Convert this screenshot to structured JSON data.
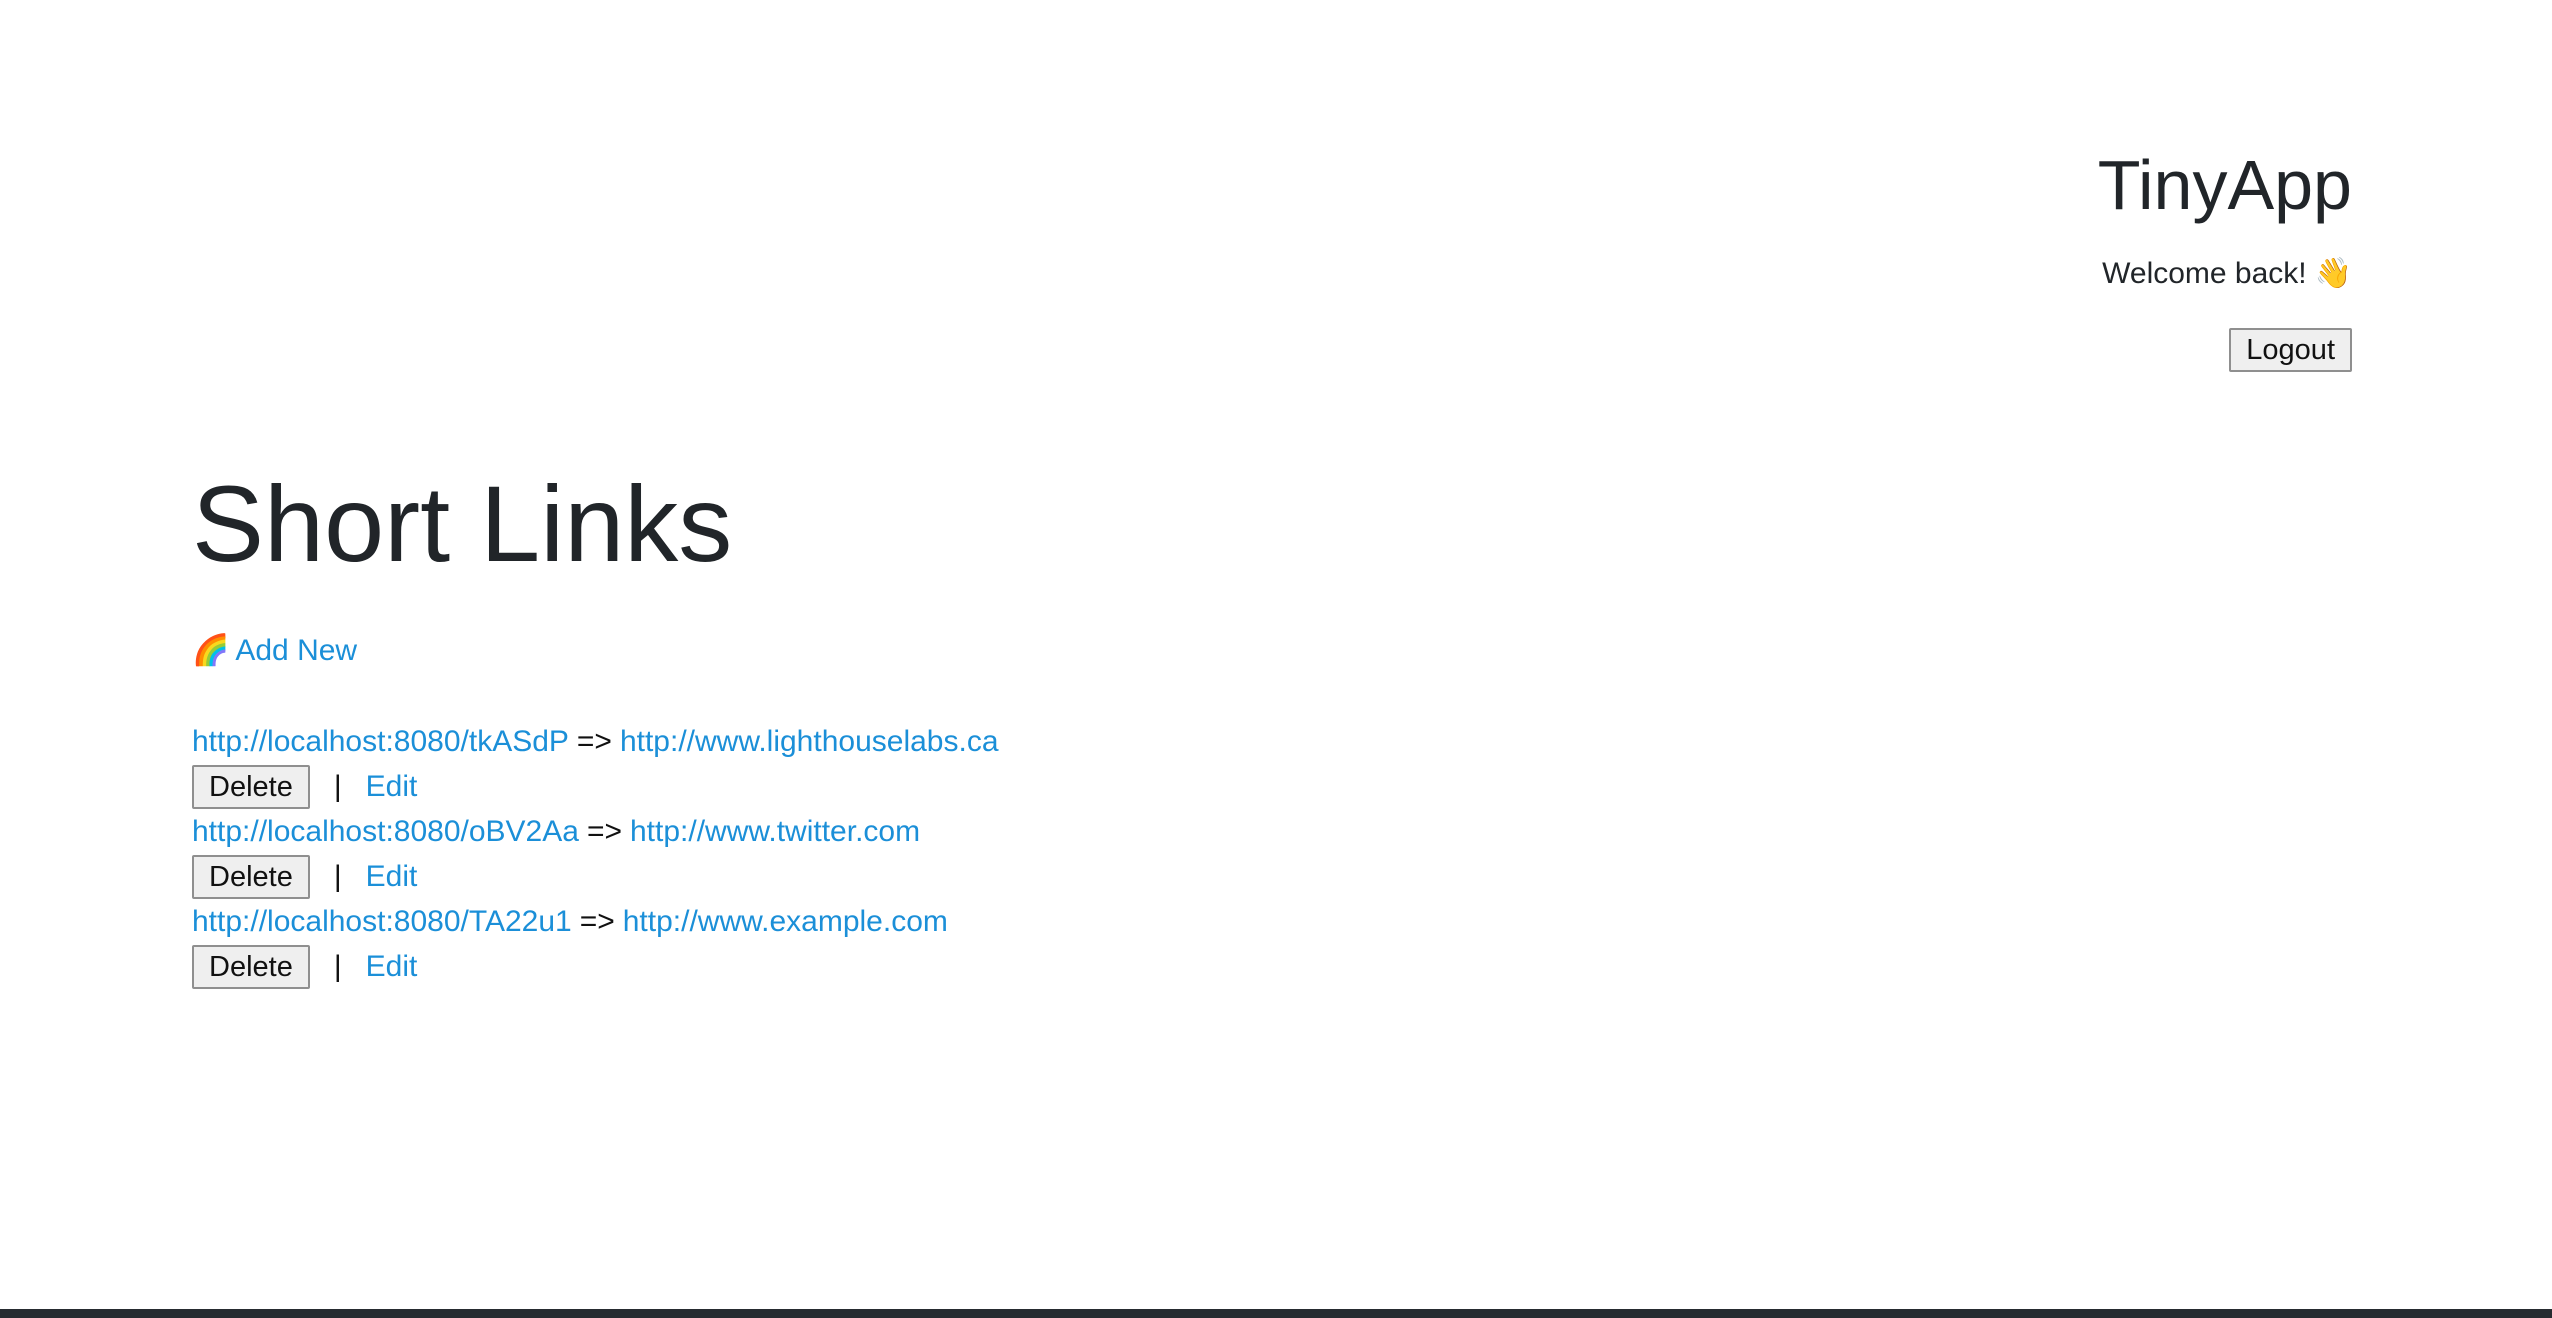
{
  "header": {
    "app_title": "TinyApp",
    "welcome_text": "Welcome back!",
    "welcome_emoji": "👋",
    "logout_label": "Logout"
  },
  "main": {
    "title": "Short Links",
    "add_new_emoji": "🌈",
    "add_new_label": "Add New",
    "urls": [
      {
        "short_url": "http://localhost:8080/tkASdP",
        "arrow": "=>",
        "long_url": "http://www.lighthouselabs.ca",
        "delete_label": "Delete",
        "separator": "|",
        "edit_label": "Edit"
      },
      {
        "short_url": "http://localhost:8080/oBV2Aa",
        "arrow": "=>",
        "long_url": "http://www.twitter.com",
        "delete_label": "Delete",
        "separator": "|",
        "edit_label": "Edit"
      },
      {
        "short_url": "http://localhost:8080/TA22u1",
        "arrow": "=>",
        "long_url": "http://www.example.com",
        "delete_label": "Delete",
        "separator": "|",
        "edit_label": "Edit"
      }
    ]
  },
  "colors": {
    "link": "#1b8fd8",
    "text": "#212529",
    "background": "#ffffff",
    "bottom_strip": "#262b30"
  }
}
